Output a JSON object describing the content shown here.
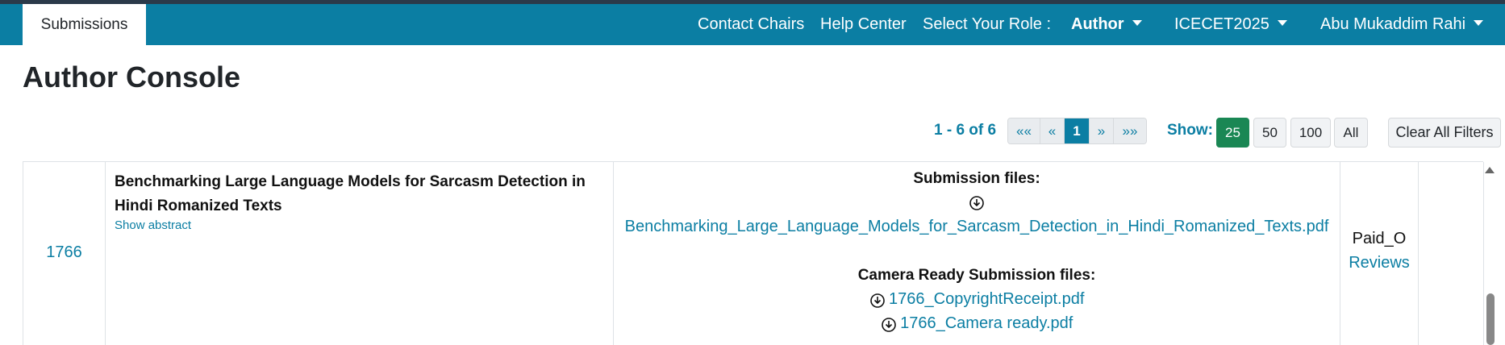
{
  "navbar": {
    "tab": "Submissions",
    "contact_chairs": "Contact Chairs",
    "help_center": "Help Center",
    "select_role": "Select Your Role :",
    "role": "Author",
    "conference": "ICECET2025",
    "user": "Abu Mukaddim Rahi"
  },
  "page": {
    "title": "Author Console"
  },
  "pagination": {
    "summary": "1 - 6 of 6",
    "first": "««",
    "prev": "«",
    "current": "1",
    "next": "»",
    "last": "»»",
    "show_label": "Show:",
    "sizes": [
      "25",
      "50",
      "100",
      "All"
    ],
    "selected_size": "25",
    "clear_filters": "Clear All Filters"
  },
  "submission": {
    "id": "1766",
    "title": "Benchmarking Large Language Models for Sarcasm Detection in Hindi Romanized Texts",
    "show_abstract": "Show abstract",
    "files_header": "Submission files:",
    "file": "Benchmarking_Large_Language_Models_for_Sarcasm_Detection_in_Hindi_Romanized_Texts.pdf",
    "camera_header": "Camera Ready Submission files:",
    "camera_files": [
      "1766_CopyrightReceipt.pdf",
      "1766_Camera ready.pdf"
    ],
    "status": "Paid_O",
    "reviews": "Reviews"
  },
  "colors": {
    "brand": "#0b7ea3",
    "active_size": "#1a8754"
  }
}
